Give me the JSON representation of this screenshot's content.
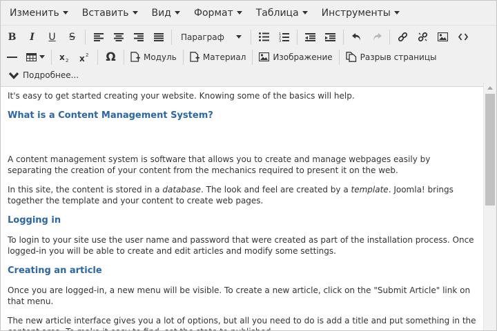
{
  "menubar": {
    "items": [
      {
        "label": "Изменить"
      },
      {
        "label": "Вставить"
      },
      {
        "label": "Вид"
      },
      {
        "label": "Формат"
      },
      {
        "label": "Таблица"
      },
      {
        "label": "Инструменты"
      }
    ]
  },
  "toolbar": {
    "format_select": "Параграф",
    "module_label": "Модуль",
    "article_label": "Материал",
    "image_label": "Изображение",
    "pagebreak_label": "Разрыв страницы",
    "more_label": "Подробнее..."
  },
  "content": {
    "intro": "It's easy to get started creating your website. Knowing some of the basics will help.",
    "h_cms": "What is a Content Management System?",
    "p_cms": "A content management system is software that allows you to create and manage webpages easily by separating the creation of your content from the mechanics required to present it on the web.",
    "p_site_1": "In this site, the content is stored in a ",
    "p_site_db": "database",
    "p_site_2": ". The look and feel are created by a ",
    "p_site_tpl": "template",
    "p_site_3": ". Joomla! brings together the template and your content to create web pages.",
    "h_login": "Logging in",
    "p_login": "To login to your site use the user name and password that were created as part of the installation process. Once logged-in you will be able to create and edit articles and modify some settings.",
    "h_article": "Creating an article",
    "p_article_1": "Once you are logged-in, a new menu will be visible. To create a new article, click on the \"Submit Article\" link on that menu.",
    "p_article_2": "The new article interface gives you a lot of options, but all you need to do is add a title and put something in the content area. To make it easy to find, set the state to published."
  }
}
